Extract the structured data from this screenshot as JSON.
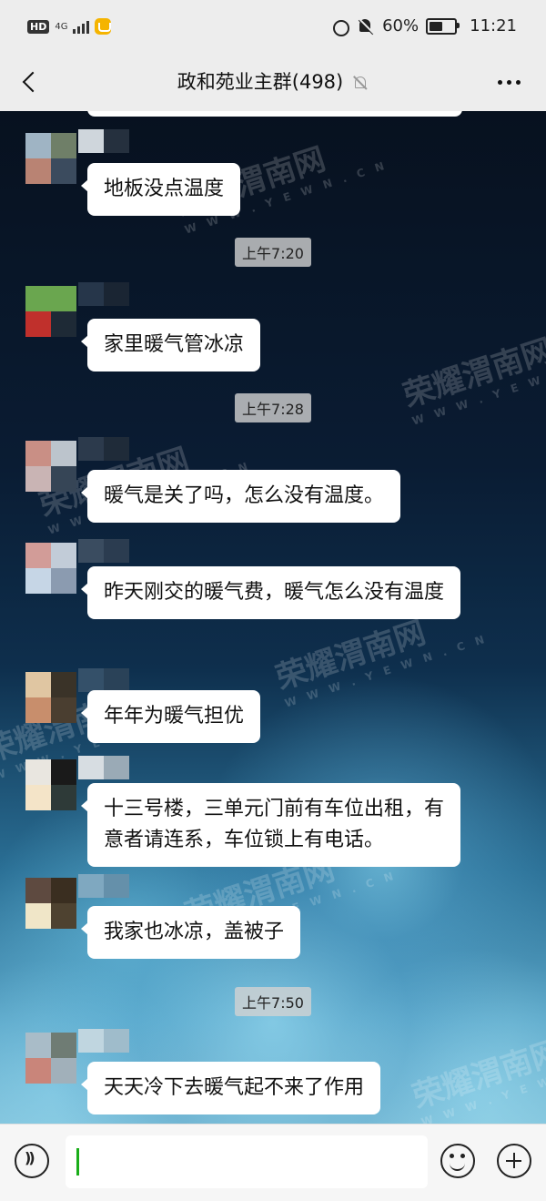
{
  "status_bar": {
    "network_badge": "HD",
    "signal_label": "4G",
    "battery_percent": "60%",
    "battery_level": 0.6,
    "time": "11:21"
  },
  "header": {
    "title": "政和苑业主群(498)",
    "back_icon": "chevron-left-icon",
    "muted_icon": "bell-muted-icon",
    "more_icon": "more-dots-icon"
  },
  "chat": {
    "messages": [
      {
        "text": "地板没点温度"
      },
      {
        "timestamp": "上午7:20"
      },
      {
        "text": "家里暖气管冰凉"
      },
      {
        "timestamp": "上午7:28"
      },
      {
        "text": "暖气是关了吗，怎么没有温度。"
      },
      {
        "text": "昨天刚交的暖气费，暖气怎么没有温度"
      },
      {
        "text": "年年为暖气担优"
      },
      {
        "text": "十三号楼，三单元门前有车位出租，有意者请连系，车位锁上有电话。"
      },
      {
        "text": "我家也冰凉，盖被子"
      },
      {
        "timestamp": "上午7:50"
      },
      {
        "text": "天天冷下去暖气起不来了作用"
      }
    ],
    "watermark": {
      "main": "荣耀渭南网",
      "sub": "W W W . Y E W N . C N"
    }
  },
  "input_bar": {
    "voice_icon": "voice-icon",
    "emoji_icon": "emoji-icon",
    "plus_icon": "plus-icon",
    "input_value": ""
  },
  "colors": {
    "bubble": "#ffffff",
    "header_bg": "#ededed",
    "cursor": "#1aad19"
  }
}
